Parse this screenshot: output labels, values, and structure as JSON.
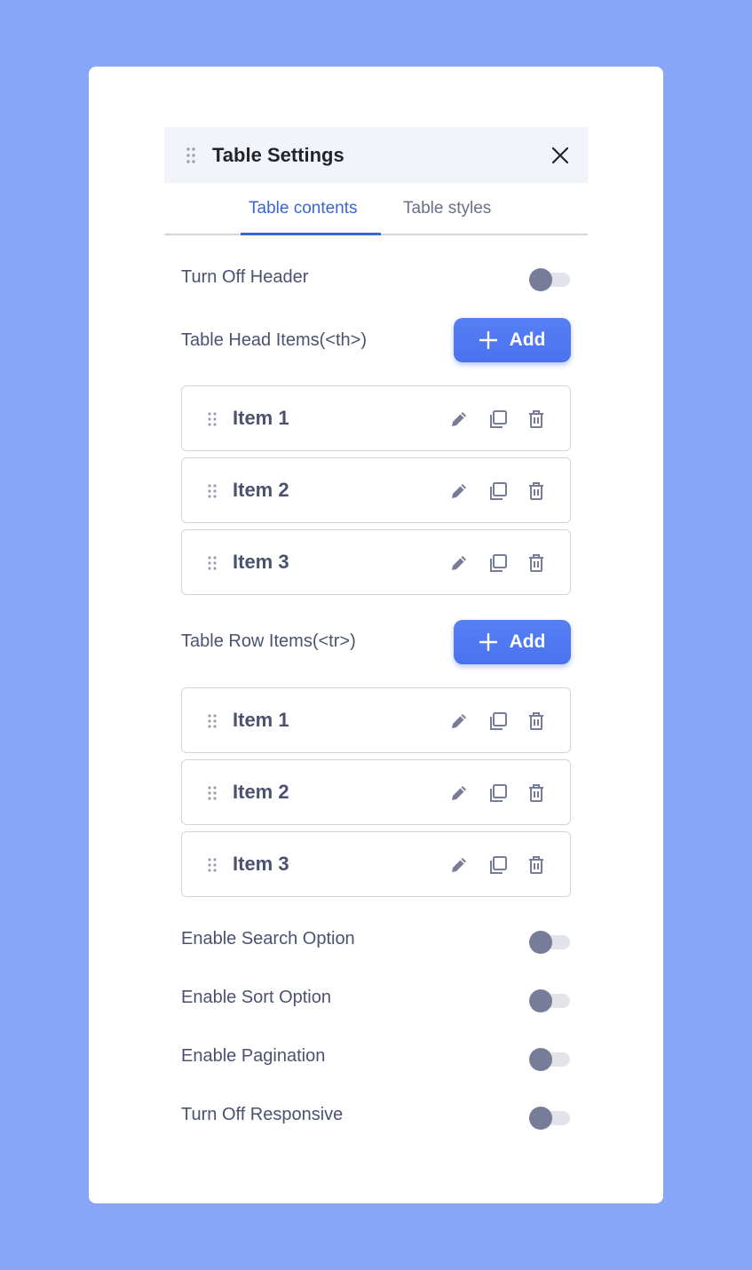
{
  "panel": {
    "title": "Table Settings",
    "tabs": [
      {
        "label": "Table contents",
        "active": true
      },
      {
        "label": "Table styles",
        "active": false
      }
    ]
  },
  "settings": {
    "turn_off_header": {
      "label": "Turn Off Header",
      "enabled": false
    },
    "head_items": {
      "label": "Table Head Items(<th>)",
      "add_label": "Add",
      "items": [
        "Item 1",
        "Item 2",
        "Item 3"
      ]
    },
    "row_items": {
      "label": "Table Row Items(<tr>)",
      "add_label": "Add",
      "items": [
        "Item 1",
        "Item 2",
        "Item 3"
      ]
    },
    "toggles": [
      {
        "label": "Enable Search Option",
        "enabled": false
      },
      {
        "label": "Enable Sort Option",
        "enabled": false
      },
      {
        "label": "Enable Pagination",
        "enabled": false
      },
      {
        "label": "Turn Off Responsive",
        "enabled": false
      }
    ]
  },
  "colors": {
    "background": "#89a5f7",
    "accent": "#3a66d4",
    "button": "#4f78f2",
    "text": "#4b5270",
    "icon": "#777c99"
  },
  "icons": [
    "drag-handle-icon",
    "close-icon",
    "plus-icon",
    "pencil-icon",
    "copy-icon",
    "trash-icon"
  ]
}
